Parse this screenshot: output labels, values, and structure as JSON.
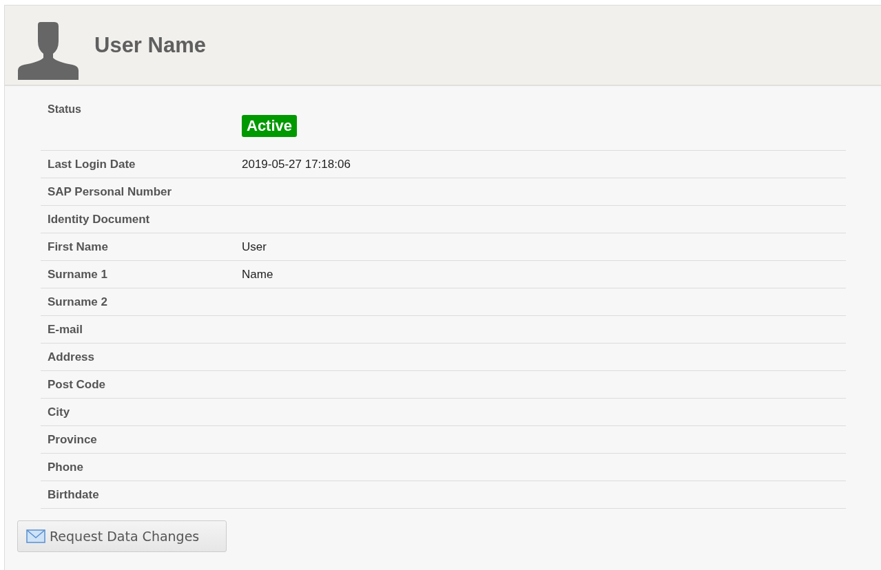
{
  "header": {
    "title": "User Name"
  },
  "fields": [
    {
      "kind": "status",
      "label": "Status",
      "value": "Active",
      "color": "#009900"
    },
    {
      "kind": "text",
      "label": "Last Login Date",
      "value": "2019-05-27 17:18:06"
    },
    {
      "kind": "text",
      "label": "SAP Personal Number"
    },
    {
      "kind": "text",
      "label": "Identity Document"
    },
    {
      "kind": "text",
      "label": "First Name",
      "value": "User"
    },
    {
      "kind": "text",
      "label": "Surname 1",
      "value": "Name"
    },
    {
      "kind": "text",
      "label": "Surname 2"
    },
    {
      "kind": "text",
      "label": "E-mail"
    },
    {
      "kind": "text",
      "label": "Address"
    },
    {
      "kind": "text",
      "label": "Post Code"
    },
    {
      "kind": "text",
      "label": "City"
    },
    {
      "kind": "text",
      "label": "Province"
    },
    {
      "kind": "text",
      "label": "Phone"
    },
    {
      "kind": "text",
      "label": "Birthdate"
    }
  ],
  "button": {
    "label": "Request Data Changes"
  }
}
